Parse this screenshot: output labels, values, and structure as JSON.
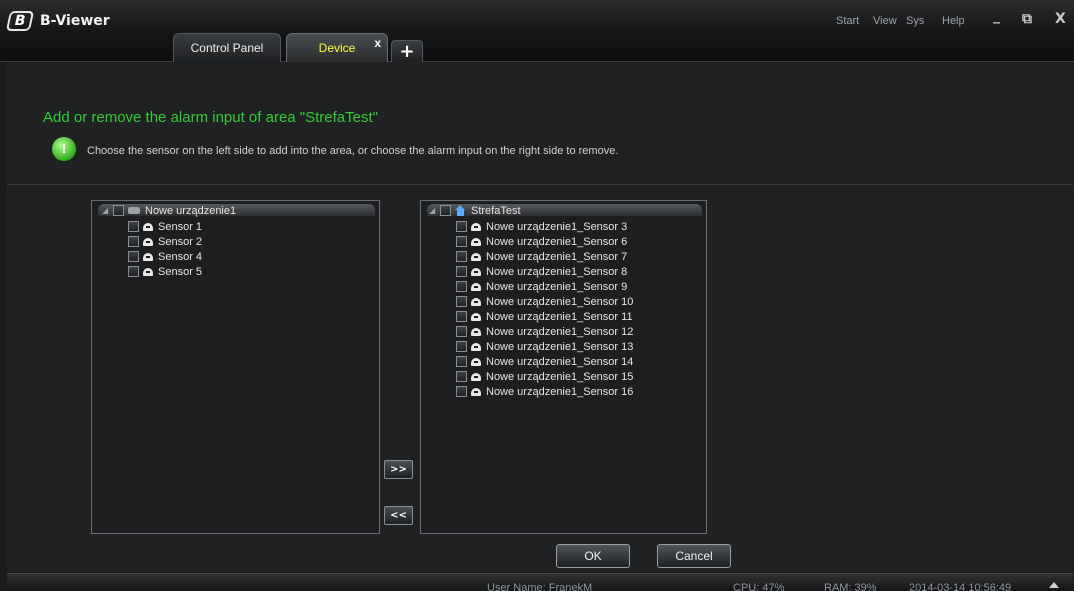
{
  "app": {
    "title": "B-Viewer",
    "logo_glyph": "B"
  },
  "menu": [
    "Start",
    "View",
    "Sys",
    "Help"
  ],
  "window_controls": {
    "minimize": "_",
    "restore": "⧉",
    "close": "X"
  },
  "tabs": [
    {
      "label": "Control Panel",
      "active": false
    },
    {
      "label": "Device",
      "active": true,
      "close": "x"
    }
  ],
  "new_tab_label": "+",
  "page": {
    "heading": "Add or remove the alarm input of area \"StrefaTest\"",
    "hint": "Choose the sensor on the left side to add into the area, or choose the alarm input on the right side to remove.",
    "hint_icon": "!"
  },
  "left_tree": {
    "root": "Nowe urządzenie1",
    "items": [
      "Sensor 1",
      "Sensor 2",
      "Sensor 4",
      "Sensor 5"
    ]
  },
  "right_tree": {
    "root": "StrefaTest",
    "items": [
      "Nowe urządzenie1_Sensor 3",
      "Nowe urządzenie1_Sensor 6",
      "Nowe urządzenie1_Sensor 7",
      "Nowe urządzenie1_Sensor 8",
      "Nowe urządzenie1_Sensor 9",
      "Nowe urządzenie1_Sensor 10",
      "Nowe urządzenie1_Sensor 11",
      "Nowe urządzenie1_Sensor 12",
      "Nowe urządzenie1_Sensor 13",
      "Nowe urządzenie1_Sensor 14",
      "Nowe urządzenie1_Sensor 15",
      "Nowe urządzenie1_Sensor 16"
    ]
  },
  "buttons": {
    "add": ">>",
    "remove": "<<",
    "ok": "OK",
    "cancel": "Cancel"
  },
  "status": {
    "user": "User Name: FranekM",
    "cpu": "CPU: 47%",
    "ram": "RAM: 39%",
    "datetime": "2014-03-14 10:56:49"
  },
  "colors": {
    "heading": "#33cc33",
    "active_tab": "#ffff33",
    "background": "#1f2123"
  }
}
